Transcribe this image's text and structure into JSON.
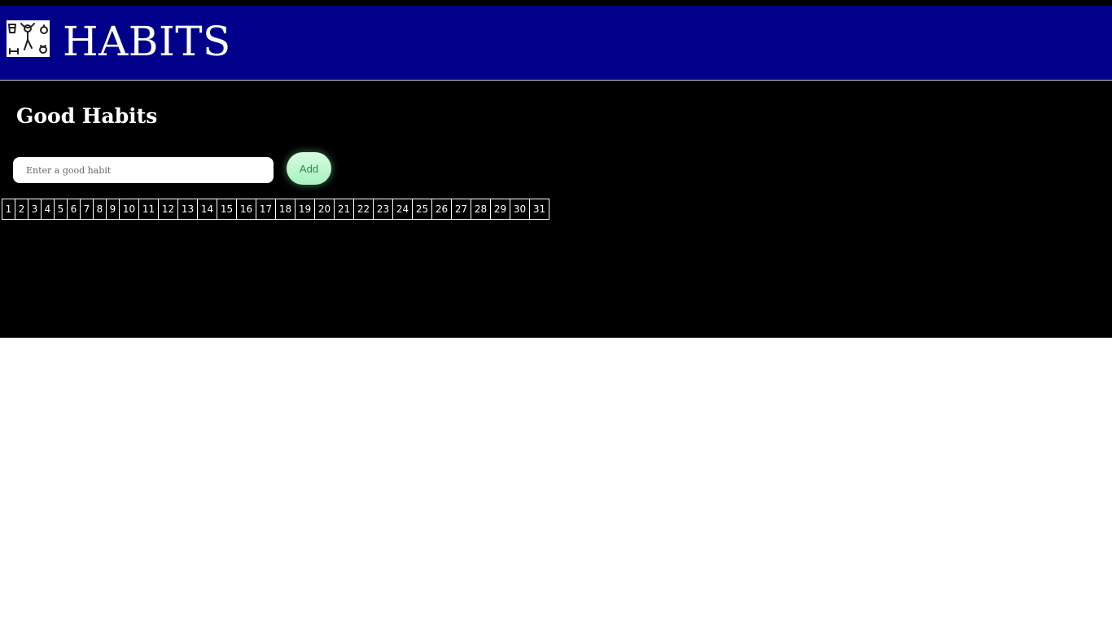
{
  "header": {
    "title": "HABITS",
    "logo_icon": "fitness-habits-logo-icon",
    "background": "#00008b"
  },
  "main": {
    "section_title": "Good Habits",
    "input": {
      "placeholder": "Enter a good habit",
      "value": ""
    },
    "add_button": "Add",
    "days": [
      "1",
      "2",
      "3",
      "4",
      "5",
      "6",
      "7",
      "8",
      "9",
      "10",
      "11",
      "12",
      "13",
      "14",
      "15",
      "16",
      "17",
      "18",
      "19",
      "20",
      "21",
      "22",
      "23",
      "24",
      "25",
      "26",
      "27",
      "28",
      "29",
      "30",
      "31"
    ]
  },
  "colors": {
    "main_background": "#000000",
    "button_green": "#a9f1c0",
    "button_text": "#2f8a44"
  }
}
